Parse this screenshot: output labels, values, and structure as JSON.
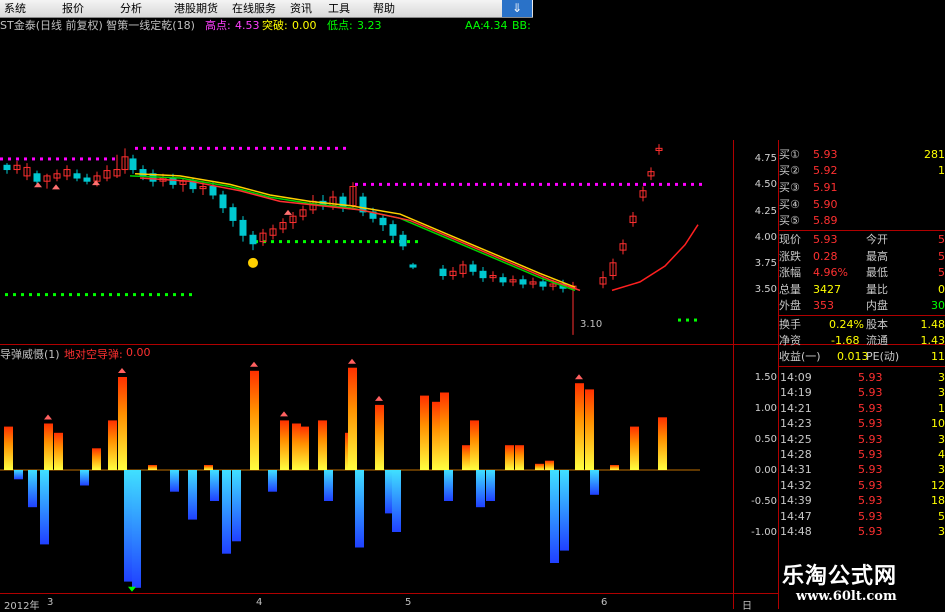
{
  "menu": {
    "items": [
      "系统",
      "报价",
      "分析",
      "港股期货",
      "在线服务",
      "资讯",
      "工具",
      "帮助"
    ],
    "underlines": [
      "S",
      "T",
      "A",
      "",
      "",
      "N",
      "",
      "H"
    ]
  },
  "header": {
    "stock": "ST金泰(日线 前复权) 智策一线定乾(18)",
    "high_label": "高点:",
    "high_value": "4.53",
    "break_label": "突破:",
    "break_value": "0.00",
    "low_label": "低点:",
    "low_value": "3.23",
    "aa_label": "AA:",
    "aa_value": "4.34",
    "bb_label": "BB:"
  },
  "subchart": {
    "title": "导弹威慑(1)",
    "value_label": "地对空导弹:",
    "value": "0.00"
  },
  "price_axis": [
    "4.75",
    "4.50",
    "4.25",
    "4.00",
    "3.75",
    "3.50"
  ],
  "ind_axis": [
    "1.50",
    "1.00",
    "0.50",
    "0.00",
    "-0.50",
    "-1.00"
  ],
  "low_annot": "3.10",
  "x_axis": {
    "year": "2012年",
    "months": [
      "3",
      "4",
      "5",
      "6"
    ],
    "period": "日"
  },
  "quote": {
    "buys": [
      {
        "label": "买①",
        "price": "5.93",
        "vol": "281"
      },
      {
        "label": "买②",
        "price": "5.92",
        "vol": "1"
      },
      {
        "label": "买③",
        "price": "5.91",
        "vol": ""
      },
      {
        "label": "买④",
        "price": "5.90",
        "vol": ""
      },
      {
        "label": "买⑤",
        "price": "5.89",
        "vol": ""
      }
    ],
    "stats": [
      {
        "l1": "现价",
        "v1": "5.93",
        "l2": "今开",
        "v2": "5"
      },
      {
        "l1": "涨跌",
        "v1": "0.28",
        "l2": "最高",
        "v2": "5"
      },
      {
        "l1": "涨幅",
        "v1": "4.96%",
        "l2": "最低",
        "v2": "5"
      },
      {
        "l1": "总量",
        "v1": "3427",
        "l2": "量比",
        "v2": "0"
      },
      {
        "l1": "外盘",
        "v1": "353",
        "l2": "内盘",
        "v2": "30"
      },
      {
        "l1": "换手",
        "v1": "0.24%",
        "l2": "股本",
        "v2": "1.48"
      },
      {
        "l1": "净资",
        "v1": "-1.68",
        "l2": "流通",
        "v2": "1.43"
      },
      {
        "l1": "收益(一)",
        "v1": "0.013",
        "l2": "PE(动)",
        "v2": "11"
      }
    ],
    "ticks": [
      {
        "time": "14:09",
        "price": "5.93",
        "vol": "3"
      },
      {
        "time": "14:19",
        "price": "5.93",
        "vol": "3"
      },
      {
        "time": "14:21",
        "price": "5.93",
        "vol": "1"
      },
      {
        "time": "14:23",
        "price": "5.93",
        "vol": "10"
      },
      {
        "time": "14:25",
        "price": "5.93",
        "vol": "3"
      },
      {
        "time": "14:28",
        "price": "5.93",
        "vol": "4"
      },
      {
        "time": "14:31",
        "price": "5.93",
        "vol": "3"
      },
      {
        "time": "14:32",
        "price": "5.93",
        "vol": "12"
      },
      {
        "time": "14:39",
        "price": "5.93",
        "vol": "18"
      },
      {
        "time": "14:47",
        "price": "5.93",
        "vol": "5"
      },
      {
        "time": "14:48",
        "price": "5.93",
        "vol": "3"
      }
    ]
  },
  "watermark": {
    "name": "乐淘公式网",
    "url": "www.60lt.com"
  },
  "colors": {
    "up": "#ff3030",
    "down": "#00d0d0",
    "magenta": "#ff00ff",
    "green": "#00ff00",
    "yellow": "#ffff00",
    "border": "#b00000"
  }
}
